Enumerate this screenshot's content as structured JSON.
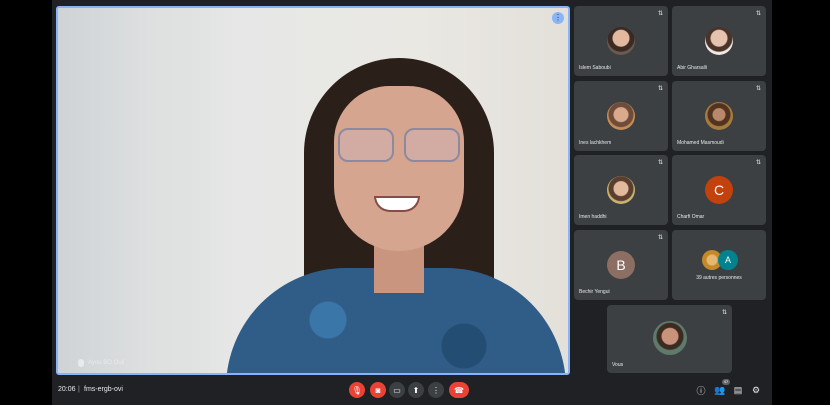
{
  "main": {
    "presenter_label": "Ayou BO Ouli"
  },
  "participants": [
    {
      "name": "Islem Saboubi",
      "avatar": "photo"
    },
    {
      "name": "Abir Gharsalli",
      "avatar": "photo2"
    },
    {
      "name": "Ines lachkhem",
      "avatar": "photo3"
    },
    {
      "name": "Mohamed Masmoudi",
      "avatar": "photo4"
    },
    {
      "name": "Imen haddhi",
      "avatar": "photo5"
    },
    {
      "name": "Charfi Omar",
      "avatar": "C"
    },
    {
      "name": "Bechir Yengui",
      "avatar": "B"
    }
  ],
  "more_tile": {
    "avatar_letter": "A",
    "text": "39 autres personnes"
  },
  "self_tile": {
    "name": "Vous"
  },
  "bottom_bar": {
    "time": "20:06",
    "separator": "|",
    "meeting_code": "fms-ergb-ovi",
    "participant_count": "47"
  },
  "controls": [
    {
      "name": "mic-off-button",
      "icon": "mic-off-icon",
      "glyph": "🎙"
    },
    {
      "name": "camera-off-button",
      "icon": "camera-off-icon",
      "glyph": "◙"
    },
    {
      "name": "captions-button",
      "icon": "captions-icon",
      "glyph": "▭"
    },
    {
      "name": "present-button",
      "icon": "present-icon",
      "glyph": "⬆"
    },
    {
      "name": "more-options-button",
      "icon": "more-vert-icon",
      "glyph": "⋮"
    },
    {
      "name": "leave-call-button",
      "icon": "phone-hangup-icon",
      "glyph": "☎"
    }
  ],
  "colors": {
    "background": "#202124",
    "tile": "#3c4043",
    "danger": "#ea4335",
    "active_border": "#8ab4f8"
  }
}
